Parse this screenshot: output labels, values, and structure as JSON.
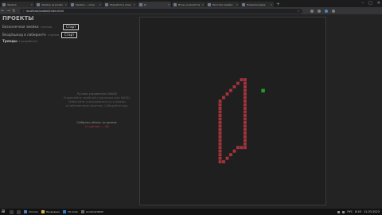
{
  "browser": {
    "tabs": [
      {
        "title": "Змейка",
        "active": false
      },
      {
        "title": "Змейка на JavaScript",
        "active": false
      },
      {
        "title": "Змейка — игра",
        "active": false
      },
      {
        "title": "Разработка игры",
        "active": false
      },
      {
        "title": "JS",
        "active": true
      },
      {
        "title": "Игры на JavaScript",
        "active": false
      },
      {
        "title": "Простая змейка",
        "active": false
      },
      {
        "title": "Новая вкладка",
        "active": false
      }
    ],
    "url": "localhost/snake/index.html"
  },
  "page": {
    "title": "ПРОЕКТЫ",
    "controls": [
      {
        "label": "Бесконечная змейка",
        "hint": "стрелки",
        "button": "Старт"
      },
      {
        "label": "Вход/выход в лабиринте",
        "hint": "стрелки",
        "button": "Старт"
      },
      {
        "label": "Тренды",
        "hint_bold": "в разработке",
        "hint": "",
        "button": ""
      }
    ],
    "info_title": "Ручное управление WASD",
    "info_lines": [
      "Управляйте змейкой стрелками или WASD.",
      "Избегайте столкновения со стенами",
      "и собственным хвостом. Собирайте еду."
    ],
    "collected_label": "Собрано яблок за время:",
    "collected_value": "0 сделок — 46"
  },
  "game": {
    "snake_color": "#a3343c",
    "food_color": "#1f9e27",
    "board_color": "#1f1f1f",
    "grid_size": 52,
    "snake_cells": [
      [
        29,
        17
      ],
      [
        28,
        17
      ],
      [
        27,
        18
      ],
      [
        26,
        19
      ],
      [
        25,
        20
      ],
      [
        24,
        21
      ],
      [
        23,
        22
      ],
      [
        22,
        23
      ],
      [
        22,
        24
      ],
      [
        22,
        25
      ],
      [
        22,
        26
      ],
      [
        22,
        27
      ],
      [
        22,
        28
      ],
      [
        22,
        29
      ],
      [
        22,
        30
      ],
      [
        22,
        31
      ],
      [
        22,
        32
      ],
      [
        22,
        33
      ],
      [
        22,
        34
      ],
      [
        22,
        35
      ],
      [
        22,
        36
      ],
      [
        22,
        37
      ],
      [
        22,
        38
      ],
      [
        22,
        39
      ],
      [
        22,
        40
      ],
      [
        23,
        40
      ],
      [
        24,
        39
      ],
      [
        25,
        38
      ],
      [
        26,
        37
      ],
      [
        27,
        36
      ],
      [
        29,
        18
      ],
      [
        29,
        19
      ],
      [
        29,
        20
      ],
      [
        29,
        21
      ],
      [
        29,
        22
      ],
      [
        29,
        23
      ],
      [
        29,
        24
      ],
      [
        29,
        25
      ],
      [
        29,
        26
      ],
      [
        29,
        27
      ],
      [
        29,
        28
      ],
      [
        29,
        29
      ],
      [
        29,
        30
      ],
      [
        29,
        31
      ],
      [
        29,
        32
      ],
      [
        29,
        33
      ],
      [
        29,
        34
      ],
      [
        29,
        35
      ],
      [
        29,
        36
      ],
      [
        28,
        36
      ]
    ],
    "food_cell": [
      34,
      20
    ]
  },
  "taskbar": {
    "apps": [
      "Chrome",
      "Проводник",
      "VS Code",
      "localhost:8000"
    ],
    "time": "8:45",
    "date": "11.03.2023",
    "lang": "РУС"
  }
}
